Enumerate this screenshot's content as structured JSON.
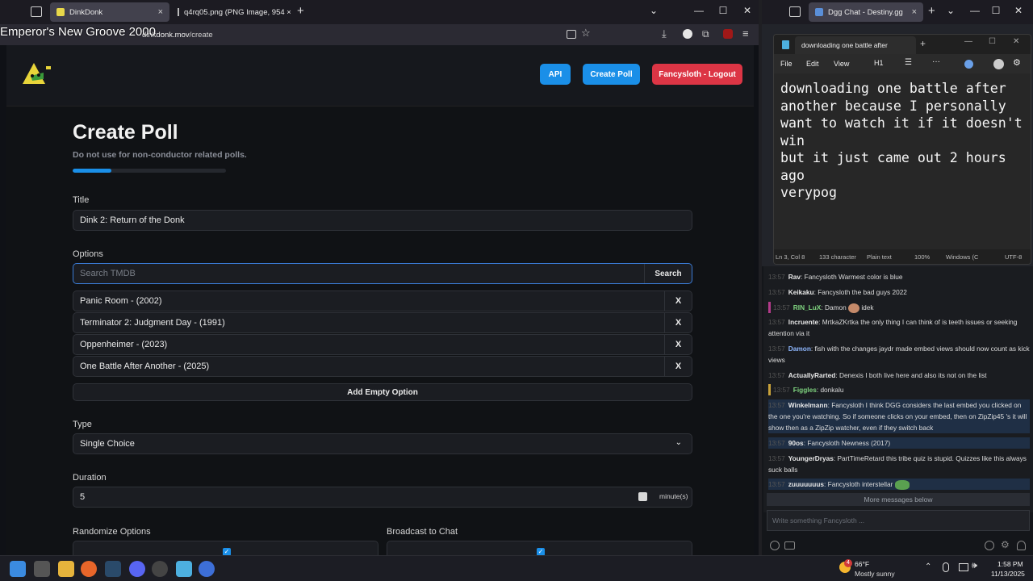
{
  "left_browser": {
    "overlay_title": "Emperor's New Groove 2000",
    "tabs": [
      {
        "label": "DinkDonk",
        "close": "×"
      },
      {
        "label": "q4rq05.png (PNG Image, 954 ×",
        "close": "×"
      }
    ],
    "new_tab": "+",
    "url_host": "dinkdonk.mov",
    "url_path": "/create"
  },
  "site": {
    "nav": {
      "api": "API",
      "create_poll": "Create Poll",
      "logout": "Fancysloth - Logout"
    },
    "heading": "Create Poll",
    "subtitle": "Do not use for non-conductor related polls.",
    "title_label": "Title",
    "title_value": "Dink 2: Return of the Donk",
    "options_label": "Options",
    "search_placeholder": "Search TMDB",
    "search_button": "Search",
    "options": [
      {
        "text": "Panic Room - (2002)",
        "remove": "X"
      },
      {
        "text": "Terminator 2: Judgment Day - (1991)",
        "remove": "X"
      },
      {
        "text": "Oppenheimer - (2023)",
        "remove": "X"
      },
      {
        "text": "One Battle After Another - (2025)",
        "remove": "X"
      }
    ],
    "add_option": "Add Empty Option",
    "type_label": "Type",
    "type_value": "Single Choice",
    "duration_label": "Duration",
    "duration_value": "5",
    "duration_unit": "minute(s)",
    "randomize_label": "Randomize Options",
    "broadcast_label": "Broadcast to Chat",
    "randomize_checked": true,
    "broadcast_checked": true,
    "progress": 0.25,
    "colors": {
      "api": "#1a8fe8",
      "create": "#1a8fe8",
      "logout": "#dc3545",
      "accent": "#1a8fe8"
    }
  },
  "right_browser": {
    "tab_label": "Dgg Chat - Destiny.gg",
    "close": "×",
    "new_tab": "+"
  },
  "notepad": {
    "tab_title": "downloading one battle after",
    "new_tab": "+",
    "menu": [
      "File",
      "Edit",
      "View"
    ],
    "heading_select": "H1",
    "text": "downloading one battle after\nanother because I personally\nwant to watch it if it doesn't\nwin\nbut it just came out 2 hours\nago\nverypog",
    "status": {
      "pos": "Ln 3, Col 8",
      "chars": "133 character",
      "mode": "Plain text",
      "zoom": "100%",
      "eol": "Windows (C",
      "enc": "UTF-8"
    }
  },
  "chat": {
    "messages": [
      {
        "user": "Rav",
        "text": "Fancysloth Warmest color is blue"
      },
      {
        "user": "Keikaku",
        "text": "Fancysloth the bad guys 2022"
      },
      {
        "user": "RIN_LuX",
        "text": "Damon",
        "emote": "idek"
      },
      {
        "user": "Incruente",
        "text": "MrtkaZKrtka the only thing I can think of is teeth issues or seeking attention via it"
      },
      {
        "user": "Damon",
        "text": "fish with the changes jaydr made embed views should now count as kick views"
      },
      {
        "user": "ActuallyRarted",
        "text": "Denexis I both live here and also its not on the list"
      },
      {
        "user": "Figgles",
        "text": "donkalu"
      },
      {
        "user": "Winkelmann",
        "text": "Fancysloth I think DGG considers the last embed you clicked on the one you're watching. So if someone clicks on your embed, then on ZipZip45 's it will show then as a ZipZip watcher, even if they switch back"
      },
      {
        "user": "90os",
        "text": "Fancysloth Newness (2017)"
      },
      {
        "user": "YoungerDryas",
        "text": "PartTimeRetard this tribe quiz is stupid. Quizzes like this always suck balls"
      },
      {
        "user": "zuuuuuuus",
        "text": "Fancysloth interstellar"
      }
    ],
    "more_below": "More messages below",
    "input_placeholder": "Write something Fancysloth ..."
  },
  "taskbar": {
    "weather_temp": "66°F",
    "weather_desc": "Mostly sunny",
    "time": "1:58 PM",
    "date": "11/13/2025",
    "weather_badge": "4"
  }
}
